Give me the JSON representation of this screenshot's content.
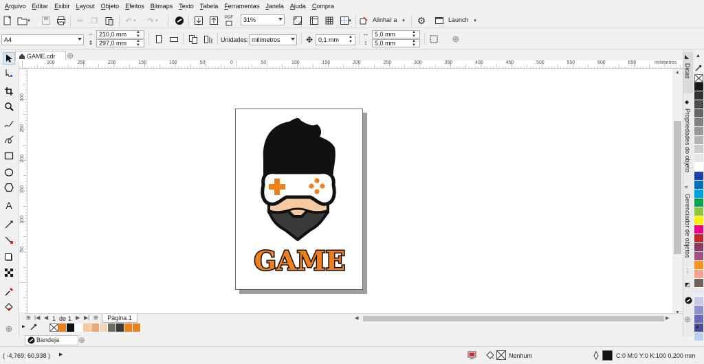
{
  "menu": [
    "Arquivo",
    "Editar",
    "Exibir",
    "Layout",
    "Objeto",
    "Efeitos",
    "Bitmaps",
    "Texto",
    "Tabela",
    "Ferramentas",
    "Janela",
    "Ajuda",
    "Compra"
  ],
  "toolbar": {
    "zoom_value": "31%",
    "align_label": "Alinhar a",
    "launch_label": "Launch",
    "pdf_label": "PDF"
  },
  "property_bar": {
    "page_size": "A4",
    "width": "210,0 mm",
    "height": "297,0 mm",
    "units_label": "Unidades:",
    "units_value": "milímetros",
    "nudge": "0,1 mm",
    "dup_x": "5,0 mm",
    "dup_y": "5,0 mm"
  },
  "document": {
    "tab_title": "GAME.cdr"
  },
  "ruler": {
    "h_ticks": [
      "300",
      "250",
      "200",
      "150",
      "100",
      "50",
      "0",
      "50",
      "100",
      "150",
      "200",
      "250",
      "300",
      "350",
      "400",
      "450",
      "500",
      "550",
      "600",
      "650"
    ],
    "unit": "milímetros",
    "v_ticks": [
      "300",
      "250",
      "200",
      "150",
      "100",
      "50"
    ]
  },
  "artwork": {
    "word": "GAME",
    "orange": "#f07f1b",
    "black": "#111111",
    "skin": "#f7c9a0",
    "beard": "#3a3a38"
  },
  "pager": {
    "current": "1",
    "of_label": "de",
    "total": "1",
    "page_tab": "Página 1"
  },
  "doc_palette": [
    "#f07f1b",
    "#111111",
    "#ffffff",
    "#f7c9a0",
    "#e8a97c",
    "#f2d4b6",
    "#6b6b5e",
    "#3a3a38",
    "#f07f1b",
    "#f07f1b"
  ],
  "bandeja_label": "Bandeja",
  "dock_panels": [
    "Dicas",
    "Propriedades do objeto",
    "Gerenciador de objetos"
  ],
  "status": {
    "coords": "( -4,769; 60,938 )",
    "fill_label": "Nenhum",
    "outline_label": "C:0 M:0 Y:0 K:100  0,200 mm"
  },
  "right_palette": [
    "#1a1a1a",
    "#333333",
    "#4d4d4d",
    "#666666",
    "#808080",
    "#999999",
    "#b3b3b3",
    "#cccccc",
    "#e6e6e6",
    "#ffffff",
    "#1f3fa8",
    "#0070c0",
    "#00a0e0",
    "#00a651",
    "#8dc63f",
    "#fff200",
    "#ec008c",
    "#c1272d",
    "#8b3a62",
    "#a0517f",
    "#f7941d",
    "#f4a28c",
    "#736357",
    "#e8e8f0",
    "#c8c8e8",
    "#9090d0",
    "#6a6ab8",
    "#4b4ba0",
    "#b8d0f0"
  ]
}
